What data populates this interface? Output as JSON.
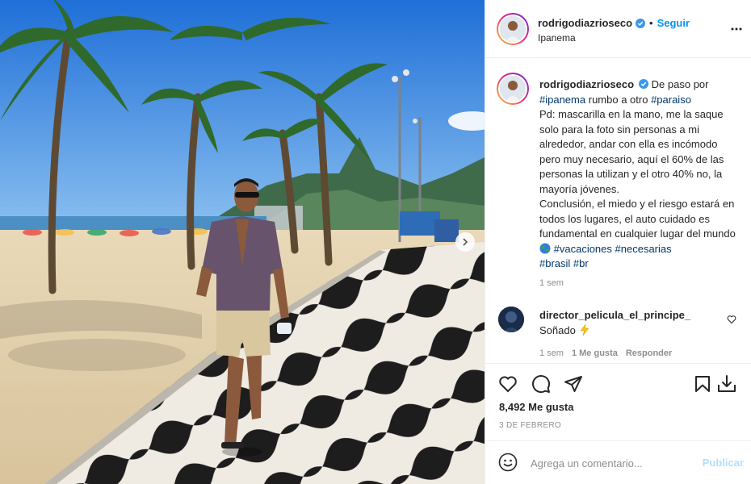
{
  "post": {
    "username": "rodrigodiazrioseco",
    "verified": true,
    "separator": "•",
    "follow_label": "Seguir",
    "location": "Ipanema",
    "more_icon": "more-options-icon"
  },
  "caption": {
    "username": "rodrigodiazrioseco",
    "lead": "De paso por",
    "tag_ipanema": "#ipanema",
    "mid": "rumbo a otro",
    "tag_paraiso": "#paraiso",
    "body": "Pd: mascarilla en la mano, me la saque solo para la foto sin personas a mi alrededor, andar con ella es incómodo pero muy necesario, aquí el 60% de las personas la utilizan y el otro 40% no, la mayoría jóvenes.",
    "body2": "Conclusión, el miedo y el riesgo estará en todos los lugares, el auto cuidado es fundamental en cualquier lugar del mundo",
    "tag_vacaciones": "#vacaciones",
    "tag_necesarias": "#necesarias",
    "tag_brasil": "#brasil",
    "tag_br": "#br",
    "time": "1 sem"
  },
  "comment": {
    "username": "director_pelicula_el_principe_",
    "text": "Soñado",
    "time": "1 sem",
    "likes": "1 Me gusta",
    "reply": "Responder"
  },
  "actions": {
    "icons": [
      "heart-icon",
      "comment-icon",
      "share-icon",
      "bookmark-icon",
      "download-icon"
    ]
  },
  "likes": "8,492 Me gusta",
  "date": "3 DE FEBRERO",
  "comment_box": {
    "placeholder": "Agrega un comentario...",
    "publish_label": "Publicar"
  },
  "colors": {
    "accent": "#0095f6",
    "hashtag": "#00376b",
    "muted": "#8e8e8e",
    "publish_disabled": "#b2dffc",
    "sky": "#2e7fd9"
  }
}
